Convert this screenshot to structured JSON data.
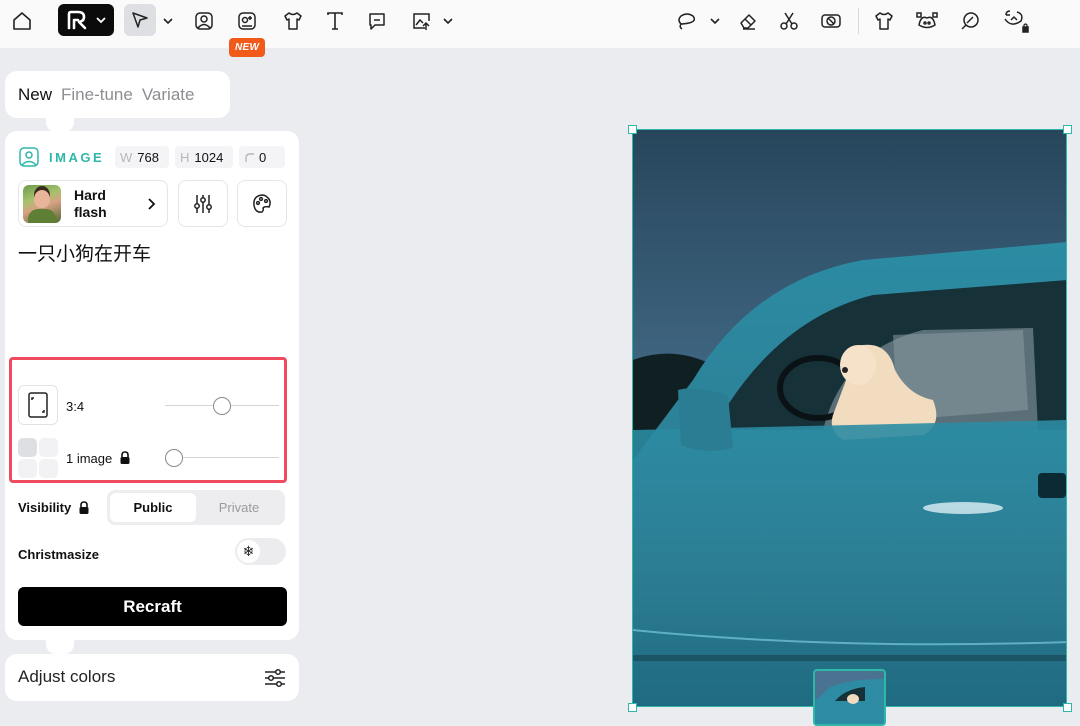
{
  "toolbar": {
    "new_badge": "NEW",
    "icons": [
      "home-icon",
      "logo-icon",
      "pointer-icon",
      "image-tool-icon",
      "vector-tool-icon",
      "tshirt-icon",
      "text-icon",
      "comment-icon",
      "export-icon",
      "lasso-icon",
      "eraser-icon",
      "scissors-icon",
      "remove-bg-icon",
      "mockup-icon",
      "vectorize-icon",
      "variations-icon",
      "upscale-icon"
    ]
  },
  "mode_tabs": [
    "New",
    "Fine-tune",
    "Variate"
  ],
  "panel": {
    "image_label": "IMAGE",
    "width_key": "W",
    "width_value": "768",
    "height_key": "H",
    "height_value": "1024",
    "corner_value": "0",
    "style_name": "Hard flash",
    "prompt": "一只小狗在开车",
    "aspect_label": "3:4",
    "aspect_level": 0.5,
    "images_label": "1 image",
    "images_level": 0.0,
    "visibility_label": "Visibility",
    "visibility_options": [
      "Public",
      "Private"
    ],
    "visibility_selected": "Public",
    "christmasize_label": "Christmasize",
    "christmasize_knob": "❄",
    "recraft_label": "Recraft"
  },
  "adjust": {
    "label": "Adjust colors"
  },
  "colors": {
    "accent": "#2fb7a9",
    "highlight": "#ef4a5f",
    "badge": "#f05a1a"
  }
}
